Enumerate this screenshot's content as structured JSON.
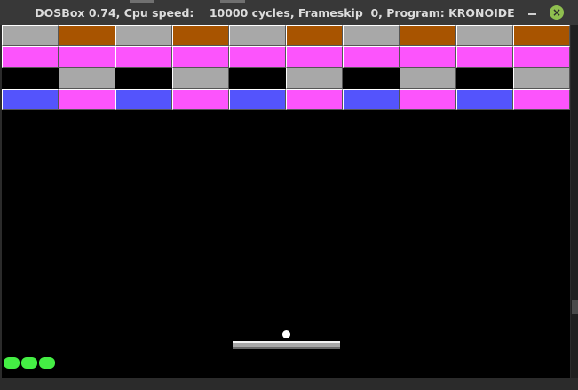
{
  "window": {
    "title": "DOSBox 0.74, Cpu speed:    10000 cycles, Frameskip  0, Program: KRONOIDE",
    "close_glyph": "×"
  },
  "colors": {
    "gray": "#a8a8a8",
    "brown": "#a85400",
    "magenta": "#fc54fc",
    "blue": "#5454fc",
    "black": "#000000",
    "paddle": "#a8a8a8",
    "ball": "#ffffff",
    "life": "#44ee44",
    "close_button": "#8fbf4f"
  },
  "game": {
    "columns": 10,
    "brick_rows": [
      [
        "gray",
        "brown",
        "gray",
        "brown",
        "gray",
        "brown",
        "gray",
        "brown",
        "gray",
        "brown"
      ],
      [
        "magenta",
        "magenta",
        "magenta",
        "magenta",
        "magenta",
        "magenta",
        "magenta",
        "magenta",
        "magenta",
        "magenta"
      ],
      [
        "black",
        "gray",
        "black",
        "gray",
        "black",
        "gray",
        "black",
        "gray",
        "black",
        "gray"
      ],
      [
        "blue",
        "magenta",
        "blue",
        "magenta",
        "blue",
        "magenta",
        "blue",
        "magenta",
        "blue",
        "magenta"
      ]
    ],
    "lives_remaining": 3
  }
}
